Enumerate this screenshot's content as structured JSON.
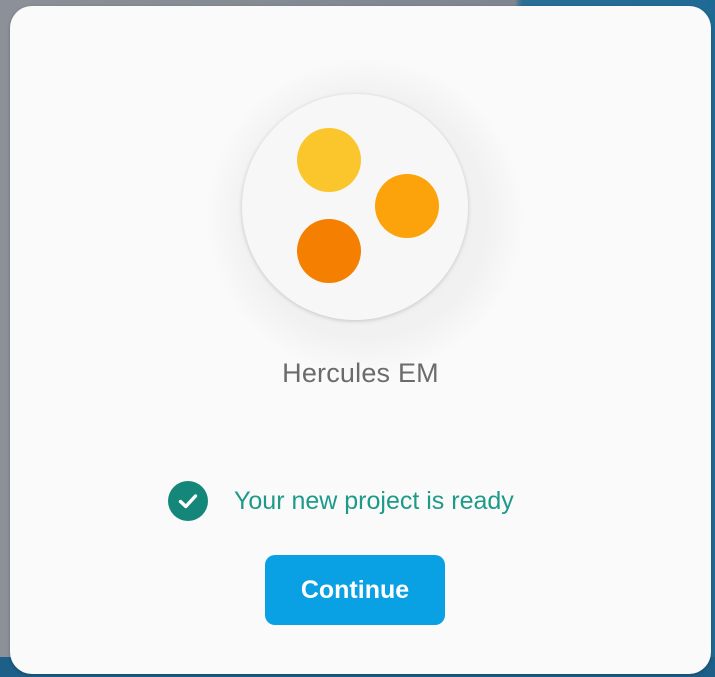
{
  "project": {
    "name": "Hercules EM",
    "logo_colors": [
      "#fbc62c",
      "#fca20a",
      "#f57f00"
    ]
  },
  "status": {
    "icon": "check-circle-icon",
    "text": "Your new project is ready",
    "color": "#1e9a8a"
  },
  "actions": {
    "continue_label": "Continue",
    "accent": "#0aa0e4"
  }
}
